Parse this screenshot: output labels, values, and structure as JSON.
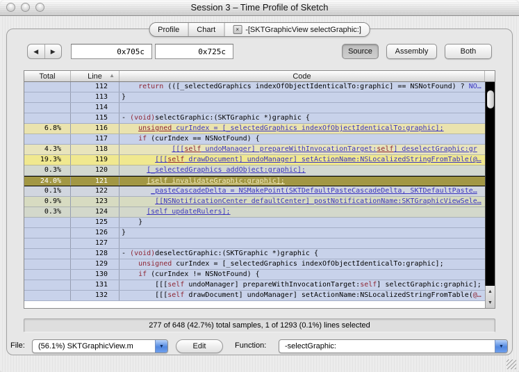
{
  "window": {
    "title": "Session 3 – Time Profile of Sketch"
  },
  "icons": {
    "back": "◀",
    "forward": "▶",
    "sort_asc": "▲",
    "popup_arrow": "▼",
    "scroll_up": "▲",
    "scroll_down": "▼",
    "tab_close": "×"
  },
  "colors": {
    "keyword": "#8e2533",
    "link": "#3a34bf",
    "selected_row": "#a29744",
    "selected_text": "#f4edc0",
    "row_default": "#c8d2ea",
    "popup_accent": "#5187e0"
  },
  "tabs": {
    "items": [
      {
        "label": "Profile",
        "closable": false
      },
      {
        "label": "Chart",
        "closable": false
      },
      {
        "label": "-[SKTGraphicView selectGraphic:]",
        "closable": true,
        "active": true
      }
    ]
  },
  "toolbar": {
    "address_start": "0x705c",
    "address_end": "0x725c",
    "view_buttons": [
      {
        "label": "Source",
        "selected": true
      },
      {
        "label": "Assembly",
        "selected": false
      },
      {
        "label": "Both",
        "selected": false
      }
    ]
  },
  "table": {
    "columns": [
      {
        "label": "Total"
      },
      {
        "label": "Line",
        "sort": "ascending"
      },
      {
        "label": "Code"
      }
    ],
    "rows": [
      {
        "total": "",
        "line": "112",
        "bg": "#c8d2ea",
        "selected": false,
        "code": [
          {
            "t": "    ",
            "s": "pl"
          },
          {
            "t": "return",
            "s": "kw"
          },
          {
            "t": " (([_selectedGraphics indexOfObjectIdenticalTo:graphic] == NSNotFound) ? ",
            "s": "pl"
          },
          {
            "t": "NO…",
            "s": "blue"
          }
        ]
      },
      {
        "total": "",
        "line": "113",
        "bg": "#c8d2ea",
        "selected": false,
        "code": [
          {
            "t": "}",
            "s": "pl"
          }
        ]
      },
      {
        "total": "",
        "line": "114",
        "bg": "#c8d2ea",
        "selected": false,
        "code": []
      },
      {
        "total": "",
        "line": "115",
        "bg": "#c8d2ea",
        "selected": false,
        "code": [
          {
            "t": "- ",
            "s": "pl"
          },
          {
            "t": "(void)",
            "s": "kw"
          },
          {
            "t": "selectGraphic:(SKTGraphic *)graphic {",
            "s": "pl"
          }
        ]
      },
      {
        "total": "6.8%",
        "line": "116",
        "bg": "#eae3ae",
        "selected": false,
        "code": [
          {
            "t": "    ",
            "s": "pl"
          },
          {
            "t": "unsigned",
            "s": "lkw"
          },
          {
            "t": " curIndex = [_selectedGraphics indexOfObjectIdenticalTo:graphic];",
            "s": "link"
          }
        ]
      },
      {
        "total": "",
        "line": "117",
        "bg": "#c8d2ea",
        "selected": false,
        "code": [
          {
            "t": "    ",
            "s": "pl"
          },
          {
            "t": "if",
            "s": "kw"
          },
          {
            "t": " (curIndex == NSNotFound) {",
            "s": "pl"
          }
        ]
      },
      {
        "total": "4.3%",
        "line": "118",
        "bg": "#e8e4bc",
        "selected": false,
        "code": [
          {
            "t": "            ",
            "s": "pl"
          },
          {
            "t": "[[[",
            "s": "link"
          },
          {
            "t": "self",
            "s": "lkw"
          },
          {
            "t": " undoManager] prepareWithInvocationTarget:",
            "s": "link"
          },
          {
            "t": "self",
            "s": "lkw"
          },
          {
            "t": "] deselectGraphic:gr",
            "s": "link"
          }
        ]
      },
      {
        "total": "19.3%",
        "line": "119",
        "bg": "#f0e88f",
        "selected": false,
        "code": [
          {
            "t": "        ",
            "s": "pl"
          },
          {
            "t": "[[[",
            "s": "link"
          },
          {
            "t": "self",
            "s": "lkw"
          },
          {
            "t": " drawDocument] undoManager] setActionName:NSLocalizedStringFromTable(@…",
            "s": "link"
          }
        ]
      },
      {
        "total": "0.3%",
        "line": "120",
        "bg": "#d3d8d0",
        "selected": false,
        "code": [
          {
            "t": "      ",
            "s": "pl"
          },
          {
            "t": "[_selectedGraphics addObject:graphic];",
            "s": "link"
          }
        ]
      },
      {
        "total": "24.0%",
        "line": "121",
        "bg": "#a29744",
        "selected": true,
        "code": [
          {
            "t": "      ",
            "s": "pl"
          },
          {
            "t": "[self invalidateGraphic:graphic];",
            "s": "sel"
          }
        ]
      },
      {
        "total": "0.1%",
        "line": "122",
        "bg": "#d1d6df",
        "selected": false,
        "code": [
          {
            "t": "       ",
            "s": "pl"
          },
          {
            "t": "_pasteCascadeDelta = NSMakePoint(SKTDefaultPasteCascadeDelta, SKTDefaultPaste…",
            "s": "link"
          }
        ]
      },
      {
        "total": "0.9%",
        "line": "123",
        "bg": "#d7dbc1",
        "selected": false,
        "code": [
          {
            "t": "        ",
            "s": "pl"
          },
          {
            "t": "[[NSNotificationCenter defaultCenter] postNotificationName:SKTGraphicViewSele…",
            "s": "link"
          }
        ]
      },
      {
        "total": "0.3%",
        "line": "124",
        "bg": "#d3d8cb",
        "selected": false,
        "code": [
          {
            "t": "      ",
            "s": "pl"
          },
          {
            "t": "[self updateRulers];",
            "s": "link"
          }
        ]
      },
      {
        "total": "",
        "line": "125",
        "bg": "#c8d2ea",
        "selected": false,
        "code": [
          {
            "t": "    }",
            "s": "pl"
          }
        ]
      },
      {
        "total": "",
        "line": "126",
        "bg": "#c8d2ea",
        "selected": false,
        "code": [
          {
            "t": "}",
            "s": "pl"
          }
        ]
      },
      {
        "total": "",
        "line": "127",
        "bg": "#c8d2ea",
        "selected": false,
        "code": []
      },
      {
        "total": "",
        "line": "128",
        "bg": "#c8d2ea",
        "selected": false,
        "code": [
          {
            "t": "- ",
            "s": "pl"
          },
          {
            "t": "(void)",
            "s": "kw"
          },
          {
            "t": "deselectGraphic:(SKTGraphic *)graphic {",
            "s": "pl"
          }
        ]
      },
      {
        "total": "",
        "line": "129",
        "bg": "#c8d2ea",
        "selected": false,
        "code": [
          {
            "t": "    ",
            "s": "pl"
          },
          {
            "t": "unsigned",
            "s": "kw"
          },
          {
            "t": " curIndex = [_selectedGraphics indexOfObjectIdenticalTo:graphic];",
            "s": "pl"
          }
        ]
      },
      {
        "total": "",
        "line": "130",
        "bg": "#c8d2ea",
        "selected": false,
        "code": [
          {
            "t": "    ",
            "s": "pl"
          },
          {
            "t": "if",
            "s": "kw"
          },
          {
            "t": " (curIndex != NSNotFound) {",
            "s": "pl"
          }
        ]
      },
      {
        "total": "",
        "line": "131",
        "bg": "#c8d2ea",
        "selected": false,
        "code": [
          {
            "t": "        [[[",
            "s": "pl"
          },
          {
            "t": "self",
            "s": "kw"
          },
          {
            "t": " undoManager] prepareWithInvocationTarget:",
            "s": "pl"
          },
          {
            "t": "self",
            "s": "kw"
          },
          {
            "t": "] selectGraphic:graphic];",
            "s": "pl"
          }
        ]
      },
      {
        "total": "",
        "line": "132",
        "bg": "#c8d2ea",
        "selected": false,
        "code": [
          {
            "t": "        [[[",
            "s": "pl"
          },
          {
            "t": "self",
            "s": "kw"
          },
          {
            "t": " drawDocument] undoManager] setActionName:NSLocalizedStringFromTable(",
            "s": "pl"
          },
          {
            "t": "@…",
            "s": "kw"
          }
        ]
      }
    ]
  },
  "status_bar": {
    "text": "277 of 648 (42.7%) total samples, 1 of 1293 (0.1%) lines selected"
  },
  "footer": {
    "file_label": "File:",
    "file_value": "(56.1%) SKTGraphicView.m",
    "edit_label": "Edit",
    "function_label": "Function:",
    "function_value": "-selectGraphic:"
  }
}
